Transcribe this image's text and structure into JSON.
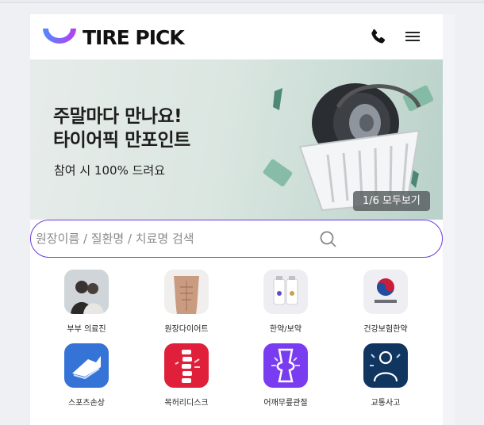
{
  "header": {
    "logo_text": "TIRE PICK",
    "phone_icon": "phone-icon",
    "menu_icon": "hamburger-menu-icon"
  },
  "banner": {
    "title_line1": "주말마다 만나요!",
    "title_line2": "타이어픽 만포인트",
    "subtitle": "참여 시 100% 드려요",
    "slide_counter": "1/6 모두보기"
  },
  "search": {
    "placeholder": "원장이름 / 질환명 / 치료명 검색",
    "value": ""
  },
  "categories": [
    {
      "label": "부부 의료진",
      "icon": "couple-photo"
    },
    {
      "label": "원장다이어트",
      "icon": "torso-photo"
    },
    {
      "label": "한약/보약",
      "icon": "herbal-medicine-bottles"
    },
    {
      "label": "건강보험한약",
      "icon": "health-insurance-logo"
    },
    {
      "label": "스포츠손상",
      "icon": "sports-injury-icon"
    },
    {
      "label": "목허리디스크",
      "icon": "spine-disc-icon"
    },
    {
      "label": "어깨무릎관절",
      "icon": "joint-icon"
    },
    {
      "label": "교통사고",
      "icon": "accident-icon"
    }
  ],
  "colors": {
    "accent": "#6a3bdc",
    "logo_gradient_start": "#4f8cff",
    "logo_gradient_end": "#b83cf0"
  }
}
